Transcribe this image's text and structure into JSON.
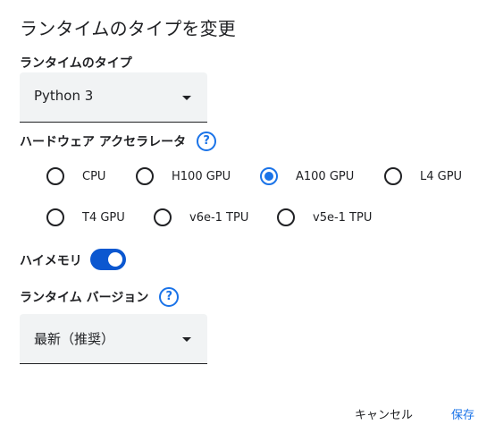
{
  "dialog": {
    "title": "ランタイムのタイプを変更"
  },
  "runtime_type": {
    "label": "ランタイムのタイプ",
    "selected": "Python 3"
  },
  "accelerator": {
    "label": "ハードウェア アクセラレータ",
    "help_icon": "?",
    "options": [
      {
        "label": "CPU",
        "checked": false
      },
      {
        "label": "H100 GPU",
        "checked": false
      },
      {
        "label": "A100 GPU",
        "checked": true
      },
      {
        "label": "L4 GPU",
        "checked": false
      },
      {
        "label": "T4 GPU",
        "checked": false
      },
      {
        "label": "v6e-1 TPU",
        "checked": false
      },
      {
        "label": "v5e-1 TPU",
        "checked": false
      }
    ],
    "checked_color": "#1a73e8"
  },
  "high_memory": {
    "label": "ハイメモリ",
    "enabled": true,
    "toggle_color": "#0b57d0"
  },
  "runtime_version": {
    "label": "ランタイム バージョン",
    "help_icon": "?",
    "selected": "最新（推奨）"
  },
  "actions": {
    "cancel_label": "キャンセル",
    "save_label": "保存",
    "accent_color": "#1a73e8"
  }
}
